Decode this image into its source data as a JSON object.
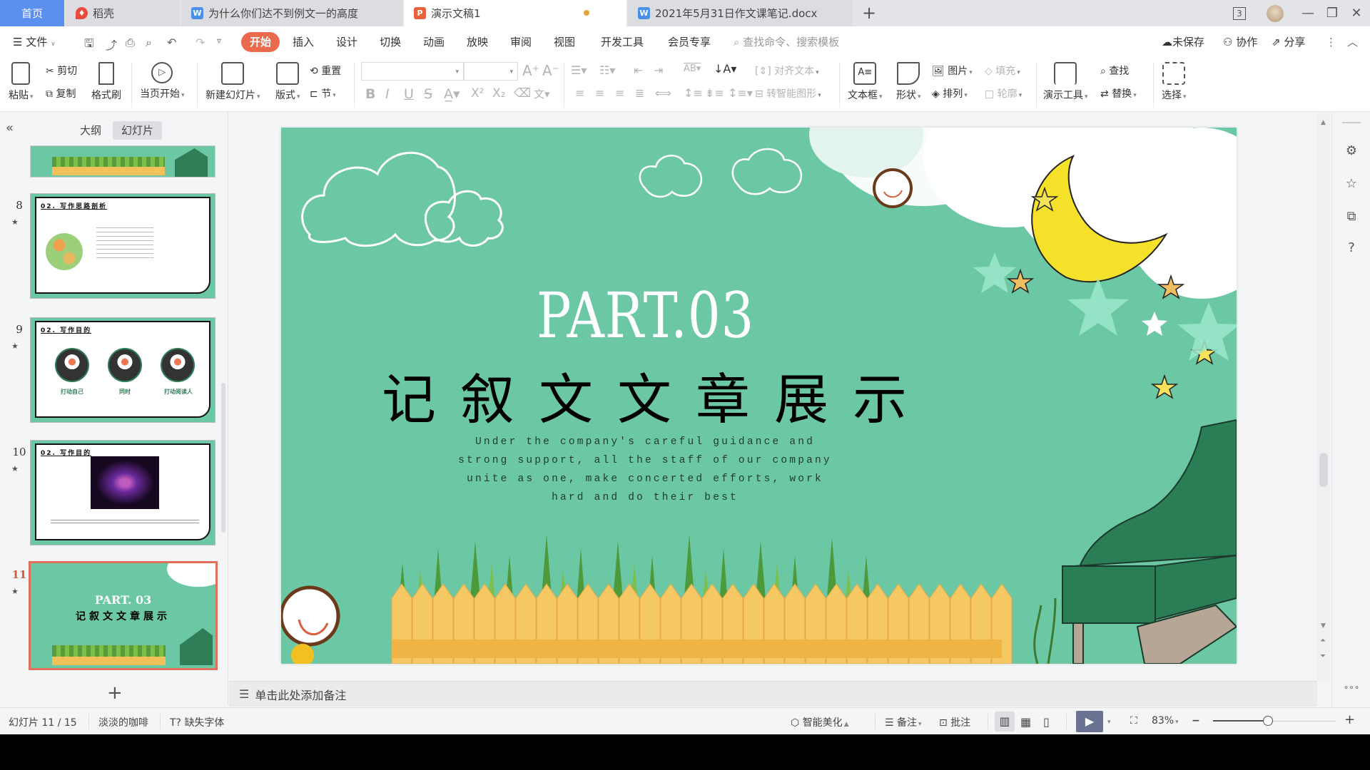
{
  "tabs": {
    "home": "首页",
    "items": [
      {
        "label": "稻壳",
        "icon": "daoke-icon",
        "color": "#e84a3c"
      },
      {
        "label": "为什么你们达不到例文一的高度",
        "icon": "wps-writer-icon",
        "color": "#4a8fe8"
      },
      {
        "label": "演示文稿1",
        "icon": "wps-presentation-icon",
        "color": "#e8623c",
        "active": true,
        "unsaved": true
      },
      {
        "label": "2021年5月31日作文课笔记.docx",
        "icon": "wps-writer-icon",
        "color": "#4a8fe8"
      }
    ],
    "new_tab": "+",
    "window_count": "3"
  },
  "menu": {
    "file": "文件",
    "items": [
      "开始",
      "插入",
      "设计",
      "切换",
      "动画",
      "放映",
      "审阅",
      "视图",
      "开发工具",
      "会员专享"
    ],
    "active": "开始",
    "search_placeholder": "查找命令、搜索模板",
    "unsaved": "未保存",
    "collab": "协作",
    "share": "分享"
  },
  "ribbon": {
    "paste": "粘贴",
    "cut": "剪切",
    "copy": "复制",
    "format_painter": "格式刷",
    "from_current": "当页开始",
    "new_slide": "新建幻灯片",
    "layout": "版式",
    "reset": "重置",
    "section": "节",
    "align_text": "对齐文本",
    "smartart": "转智能图形",
    "textbox": "文本框",
    "shape": "形状",
    "picture": "图片",
    "fill": "填充",
    "arrange": "排列",
    "outline": "轮廓",
    "present_tools": "演示工具",
    "find": "查找",
    "replace": "替换",
    "select": "选择",
    "font_name": "",
    "font_size": ""
  },
  "left_panel": {
    "outline_tab": "大纲",
    "slides_tab": "幻灯片",
    "thumbs": [
      {
        "num": "8",
        "title": "02. 写作思路剖析"
      },
      {
        "num": "9",
        "title": "02. 写作目的",
        "captions": [
          "打动自己",
          "同时",
          "打动阅读人"
        ]
      },
      {
        "num": "10",
        "title": "02. 写作目的"
      },
      {
        "num": "11",
        "title": "PART. 03",
        "subtitle": "记叙文文章展示",
        "selected": true
      }
    ]
  },
  "slide": {
    "part": "PART.03",
    "title": "记叙文文章展示",
    "body": "Under the company's careful guidance and strong support, all the staff of our company unite as one, make concerted efforts, work hard and do their best",
    "bg_color": "#6cc8a4"
  },
  "notes": {
    "placeholder": "单击此处添加备注"
  },
  "status": {
    "slide_indicator": "幻灯片 11 / 15",
    "theme": "淡淡的咖啡",
    "missing_font": "缺失字体",
    "beautify": "智能美化",
    "notes": "备注",
    "comment": "批注",
    "zoom": "83%",
    "zoom_fraction": 0.83
  }
}
